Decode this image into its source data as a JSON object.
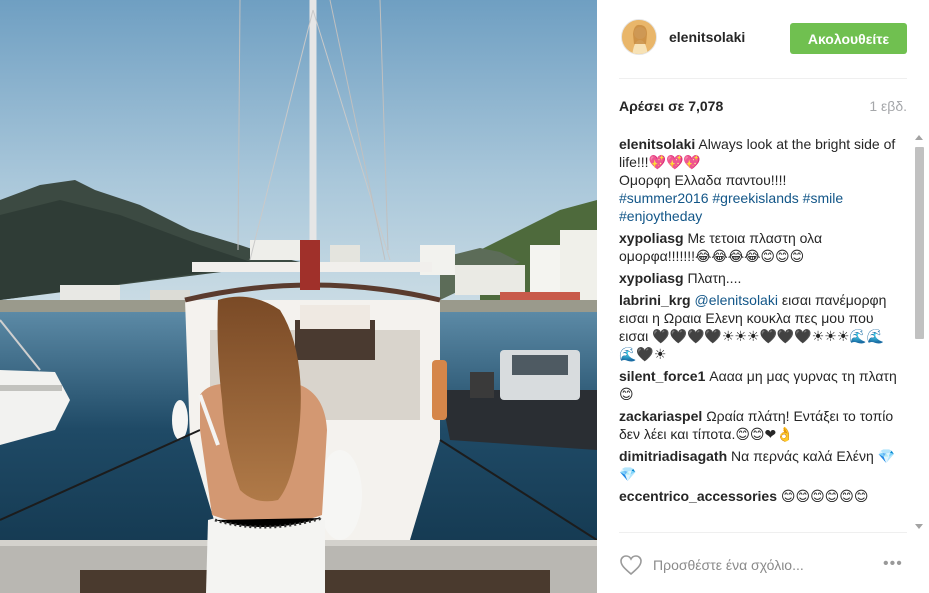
{
  "post": {
    "photo_alt": "",
    "username": "elenitsolaki",
    "follow_label": "Ακολουθείτε",
    "likes_text": "Αρέσει σε 7,078",
    "time_text": "1 εβδ."
  },
  "caption": {
    "user": "elenitsolaki",
    "text": "Always look at the bright side of life!!!💖💖💖",
    "line2": "Ομορφη Ελλαδα παντου!!!!",
    "tags": [
      "#summer2016",
      "#greekislands",
      "#smile",
      "#enjoytheday"
    ]
  },
  "comments": [
    {
      "user": "xypoliasg",
      "text": "Με τετοια πλαστη ολα ομορφα!!!!!!!😂😂😂😂😊😊😊"
    },
    {
      "user": "xypoliasg",
      "text": "Πλατη...."
    },
    {
      "user": "labrini_krg",
      "mention": "@elenitsolaki",
      "text": " εισαι πανέμορφη εισαι η Ωραια Ελενη κουκλα πες μου που εισαι 🖤🖤🖤🖤☀☀☀🖤🖤🖤☀☀☀🌊🌊🌊🖤☀"
    },
    {
      "user": "silent_force1",
      "text": "Αααα μη μας γυρνας τη πλατη 😊"
    },
    {
      "user": "zackariaspel",
      "text": "Ωραία πλάτη! Εντάξει το τοπίο δεν λέει και τίποτα.😊😊❤👌"
    },
    {
      "user": "dimitriadisagath",
      "text": "Να περνάς καλά Ελένη 💎💎"
    },
    {
      "user": "eccentrico_accessories",
      "text": "😊😊😊😊😊😊"
    }
  ],
  "footer": {
    "comment_placeholder": "Προσθέστε ένα σχόλιο...",
    "more_label": "•••"
  },
  "icons": {
    "heart": "heart-outline-icon",
    "more": "more-options-icon"
  },
  "colors": {
    "follow_button": "#70c050",
    "hashtag": "#125688",
    "muted": "#a5a7aa"
  }
}
